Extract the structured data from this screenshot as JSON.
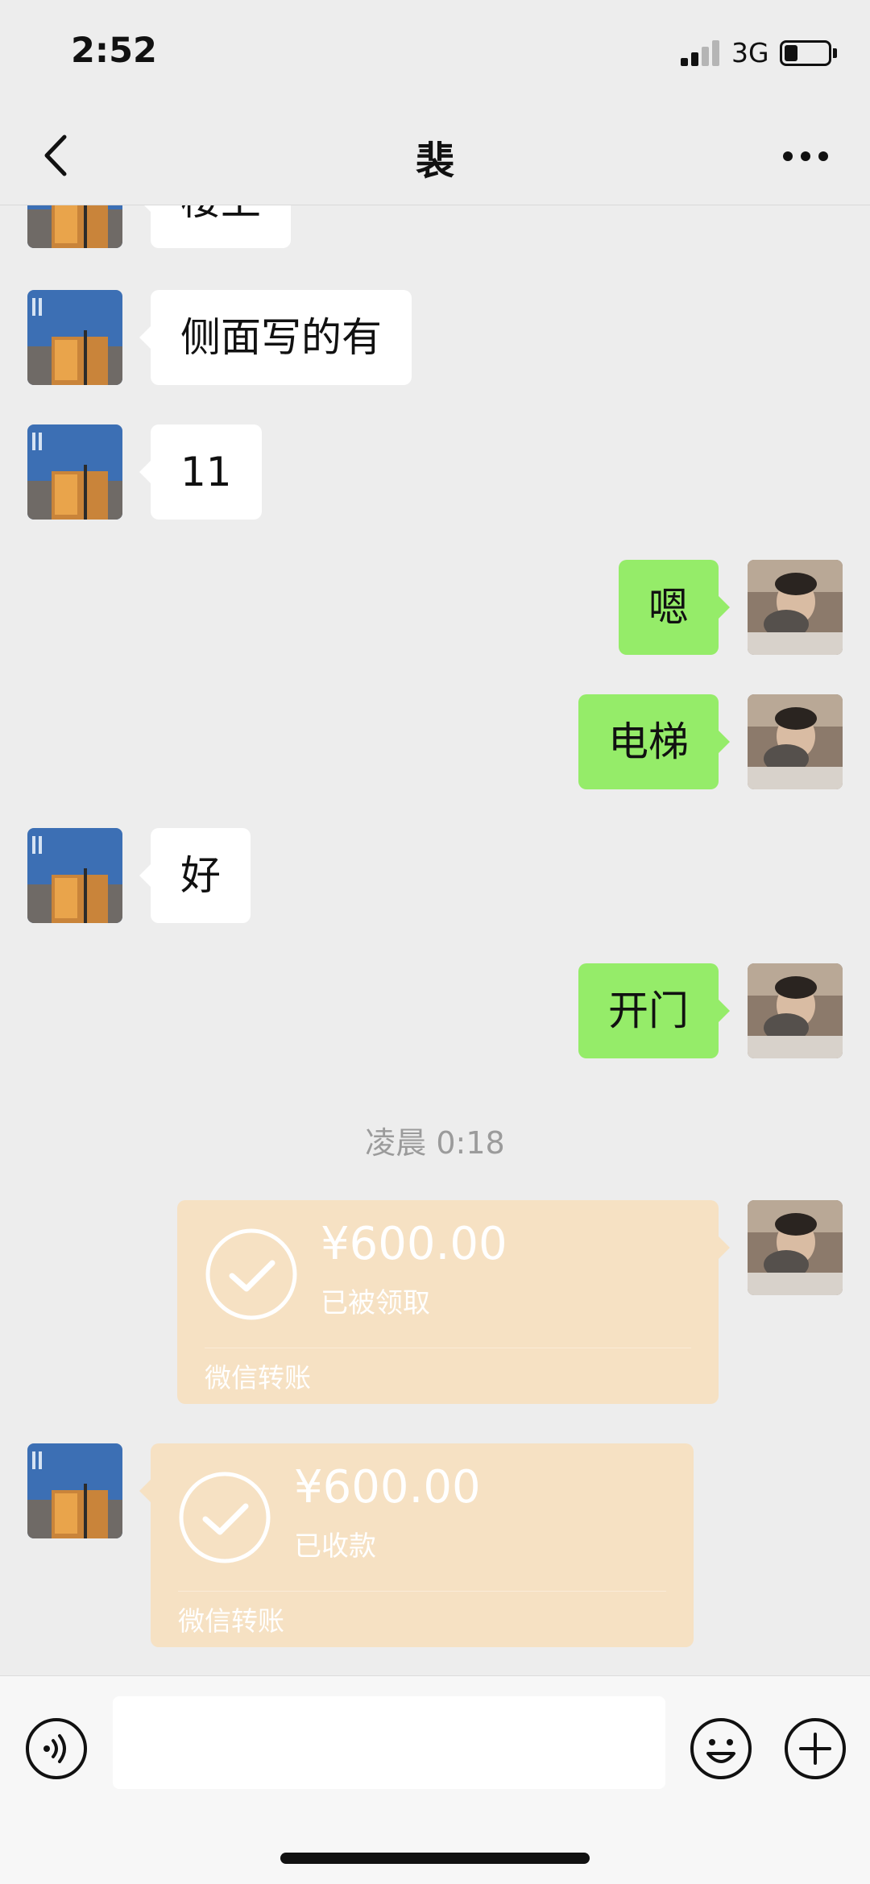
{
  "status_bar": {
    "time": "2:52",
    "network": "3G",
    "signal_bars_filled": 2,
    "signal_bars_total": 4,
    "battery_level": 0.25
  },
  "nav": {
    "title": "裴",
    "back_icon": "chevron-left-icon",
    "more_icon": "ellipsis-icon"
  },
  "messages": [
    {
      "side": "in",
      "text": "楼上"
    },
    {
      "side": "in",
      "text": "侧面写的有"
    },
    {
      "side": "in",
      "text": "11"
    },
    {
      "side": "out",
      "text": "嗯"
    },
    {
      "side": "out",
      "text": "电梯"
    },
    {
      "side": "in",
      "text": "好"
    },
    {
      "side": "out",
      "text": "开门"
    }
  ],
  "timestamp": "凌晨 0:18",
  "transfers": [
    {
      "side": "out",
      "amount": "¥600.00",
      "status": "已被领取",
      "footer": "微信转账"
    },
    {
      "side": "in",
      "amount": "¥600.00",
      "status": "已收款",
      "footer": "微信转账"
    }
  ],
  "input_bar": {
    "voice_icon": "voice-icon",
    "emoji_icon": "emoji-icon",
    "plus_icon": "plus-icon",
    "input_value": ""
  },
  "colors": {
    "background": "#ededed",
    "bubble_out": "#95ec69",
    "bubble_in": "#ffffff",
    "transfer_card": "#f6e1c3"
  }
}
